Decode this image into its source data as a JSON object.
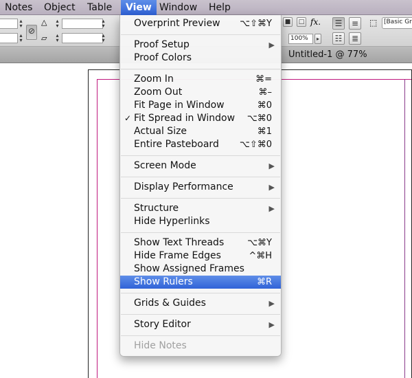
{
  "menubar": {
    "items": [
      {
        "label": "Notes"
      },
      {
        "label": "Object"
      },
      {
        "label": "Table"
      },
      {
        "label": "View",
        "active": true
      },
      {
        "label": "Window"
      },
      {
        "label": "Help"
      }
    ]
  },
  "controlbar": {
    "zoom_value": "100%",
    "fx_label": "fx.",
    "style_dropdown": "[Basic Gr"
  },
  "document": {
    "tab_title": "Untitled-1 @ 77%"
  },
  "view_menu": {
    "items": [
      {
        "label": "Overprint Preview",
        "shortcut": "⌥⇧⌘Y"
      },
      {
        "label": "Proof Setup",
        "submenu": "▶"
      },
      {
        "label": "Proof Colors"
      },
      {
        "label": "Zoom In",
        "shortcut": "⌘="
      },
      {
        "label": "Zoom Out",
        "shortcut": "⌘–"
      },
      {
        "label": "Fit Page in Window",
        "shortcut": "⌘0"
      },
      {
        "label": "Fit Spread in Window",
        "shortcut": "⌥⌘0",
        "check": "✓"
      },
      {
        "label": "Actual Size",
        "shortcut": "⌘1"
      },
      {
        "label": "Entire Pasteboard",
        "shortcut": "⌥⇧⌘0"
      },
      {
        "label": "Screen Mode",
        "submenu": "▶"
      },
      {
        "label": "Display Performance",
        "submenu": "▶"
      },
      {
        "label": "Structure",
        "submenu": "▶"
      },
      {
        "label": "Hide Hyperlinks"
      },
      {
        "label": "Show Text Threads",
        "shortcut": "⌥⌘Y"
      },
      {
        "label": "Hide Frame Edges",
        "shortcut": "^⌘H"
      },
      {
        "label": "Show Assigned Frames"
      },
      {
        "label": "Show Rulers",
        "shortcut": "⌘R",
        "highlighted": true
      },
      {
        "label": "Grids & Guides",
        "submenu": "▶"
      },
      {
        "label": "Story Editor",
        "submenu": "▶"
      },
      {
        "label": "Hide Notes",
        "disabled": true
      }
    ]
  },
  "colors": {
    "highlight": "#3a6ddc",
    "page_margin": "#c0187e"
  }
}
